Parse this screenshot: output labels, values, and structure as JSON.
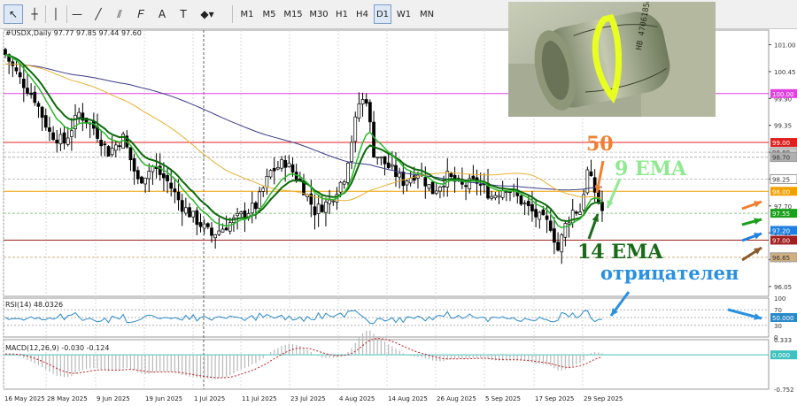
{
  "toolbar": {
    "tools": [
      {
        "name": "cursor-icon",
        "glyph": "↖",
        "active": true
      },
      {
        "name": "crosshair-icon",
        "glyph": "┼",
        "active": false
      },
      {
        "name": "vertical-line-icon",
        "glyph": "│",
        "active": false
      },
      {
        "name": "horizontal-line-icon",
        "glyph": "—",
        "active": false
      },
      {
        "name": "trendline-icon",
        "glyph": "╱",
        "active": false
      },
      {
        "name": "channel-icon",
        "glyph": "⫽",
        "active": false
      },
      {
        "name": "fibonacci-icon",
        "glyph": "𝐹",
        "active": false
      },
      {
        "name": "text-icon",
        "glyph": "A",
        "active": false
      },
      {
        "name": "label-icon",
        "glyph": "T",
        "active": false
      },
      {
        "name": "shapes-icon",
        "glyph": "◆▾",
        "active": false
      }
    ],
    "timeframes": [
      "M1",
      "M5",
      "M15",
      "M30",
      "H1",
      "H4",
      "D1",
      "W1",
      "MN"
    ],
    "active_timeframe": "D1"
  },
  "chart_header": {
    "symbol_line": "#USDX,Daily  97.77 97.85 97.44 97.60"
  },
  "price_axis": {
    "ticks": [
      "101.00",
      "100.45",
      "99.90",
      "99.35",
      "98.80",
      "98.25",
      "97.70",
      "97.15",
      "96.60",
      "96.05"
    ],
    "labels": [
      {
        "text": "100.00",
        "color": "#e040e0"
      },
      {
        "text": "99.00",
        "color": "#e02020"
      },
      {
        "text": "98.80",
        "color": "#c8c8c8"
      },
      {
        "text": "98.70",
        "color": "#b0b0b0"
      },
      {
        "text": "98.25",
        "color": "#ffffff"
      },
      {
        "text": "98.00",
        "color": "#f0a000"
      },
      {
        "text": "97.55",
        "color": "#1aa01a"
      },
      {
        "text": "97.20",
        "color": "#2080e0"
      },
      {
        "text": "97.00",
        "color": "#a02020"
      },
      {
        "text": "96.65",
        "color": "#d0b080"
      }
    ]
  },
  "rsi": {
    "label": "RSI(14) 48.0326",
    "ticks": [
      "100",
      "70",
      "50.000",
      "30",
      "0"
    ],
    "value": 48.0326
  },
  "macd": {
    "label": "MACD(12,26,9) -0.030 -0.124",
    "ticks": [
      "0.333",
      "0.000",
      "-0.752"
    ]
  },
  "time_axis": [
    "16 May 2025",
    "28 May 2025",
    "9 Jun 2025",
    "19 Jun 2025",
    "1 Jul 2025",
    "11 Jul 2025",
    "23 Jul 2025",
    "4 Aug 2025",
    "14 Aug 2025",
    "26 Aug 2025",
    "5 Sep 2025",
    "17 Sep 2025",
    "29 Sep 2025"
  ],
  "annotations": {
    "ema50": {
      "text": "50",
      "color": "#f08030"
    },
    "ema9": {
      "text": "9 EMA",
      "color": "#90e890"
    },
    "ema14": {
      "text": "14 EMA",
      "color": "#1a6a1a"
    },
    "rsi_note": {
      "text": "отрицателен",
      "color": "#2a90e0"
    }
  },
  "photo_banknote": {
    "number_text": "HB 47061850"
  },
  "colors": {
    "ema9": "#2ab82a",
    "ema14": "#0a6a0a",
    "sma50": "#e8b030",
    "sma100": "#3a3a8a",
    "level_100": "#e040e0",
    "level_99": "#e02020",
    "level_98": "#f0a000",
    "level_97": "#a02020"
  }
}
